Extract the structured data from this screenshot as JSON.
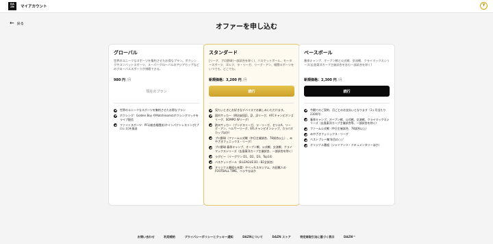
{
  "topbar": {
    "logo": "DA ZN",
    "title": "マイアカウント",
    "avatar": "Y"
  },
  "back_label": "戻る",
  "page_title": "オファーを申し込む",
  "plans": [
    {
      "name": "グローバル",
      "description": "世界のユニークなスポーツを集約させたお得なプラン。ボクシングやコンバットスポーツ、スーパーグローバルのアジアカップなどのグローバルスポーツが視聴できる。",
      "price_label": "",
      "price": "980 円",
      "price_unit": "/月",
      "cta": "現在のプラン",
      "features": [
        "世界のユニークなスポーツを集約させたお得なプラン",
        "ボクシング：Golden Boy やMatchroomのボクシングマッチをライブ配信",
        "ファイトスポーツ：PFL(総合格闘技)やインパクトレスリング(プロレス)を放送"
      ]
    },
    {
      "name": "スタンダード",
      "description": "Jリーグ、プロ野球(一部試合を除く)、バスケットボール、モータースポーツ、ゴルフ、ラ・リーガ、リーグ・アン、格闘スポーツをいつでも、どこでも。",
      "price_label": "新規価格：",
      "price": "3,200 円",
      "price_unit": "/月",
      "cta": "続行",
      "features": [
        "見たいときにお好きなデバイスでお楽しみいただけます。",
        "国内サッカー（明治安田J1、J2、J3リーグ、AFCチャンピオンズリーグ、SOMPO Wリーグ）",
        "欧州サッカー（ブンデスリーガ、ラ・リーガ、セリエA、リーグ・アン、ヘルサーリーグ、EFLチャンピオンシップ、カラバオカップほか）",
        "プロ野球（ファーム公式戦（中日主催試合、78試合以上）、みやざきフェニックス・リーグ）",
        "プロ野球 春季キャンプ、オープン戦、公式戦、交流戦、クライマックスシリーズ（広島東洋カープ主催試合、一部試合を除く）",
        "ラグビー（リーグワン D1、D2、D3、Top14）",
        "バスケットボール（B.LEAGUE B1・B2全試合）",
        "オリジナル番組も充実！やべっちスタジアム、内田篤人のFOOTBALL TIME、ベラサなほか"
      ]
    },
    {
      "name": "ベースボール",
      "description": "春季キャンプ、オープン戦と公式戦、交流戦、クライマックスシリーズ(広島東洋カープ主催試合を含む一部試合を除く)",
      "price_label": "新規価格：",
      "price": "2,300 円",
      "price_unit": "/月",
      "cta": "続行",
      "features": [
        "今観てのご契約、月ごとのお支払いとなります（1ヶ月当たり2300円）",
        "春季キャンプ、オープン戦、公式戦、交流戦、クライマックスシリーズ（広島東洋カープ主催試合等、一部試合を除く）",
        "ファーム公式戦（中日主催試合、78試合以上）",
        "みやざきフェニックス・リーグ",
        "ベストプレー集'年目の○○'",
        "オリジナル番組（ジャイアンツ・ドキュメンタリーほか）"
      ]
    }
  ],
  "footer_links": [
    "お問い合わせ",
    "利用規約",
    "プライバシーポリシーとクッキー通知",
    "DAZNについて",
    "DAZN ストア",
    "特定商取引法に基づく表示",
    "DAZN™"
  ]
}
